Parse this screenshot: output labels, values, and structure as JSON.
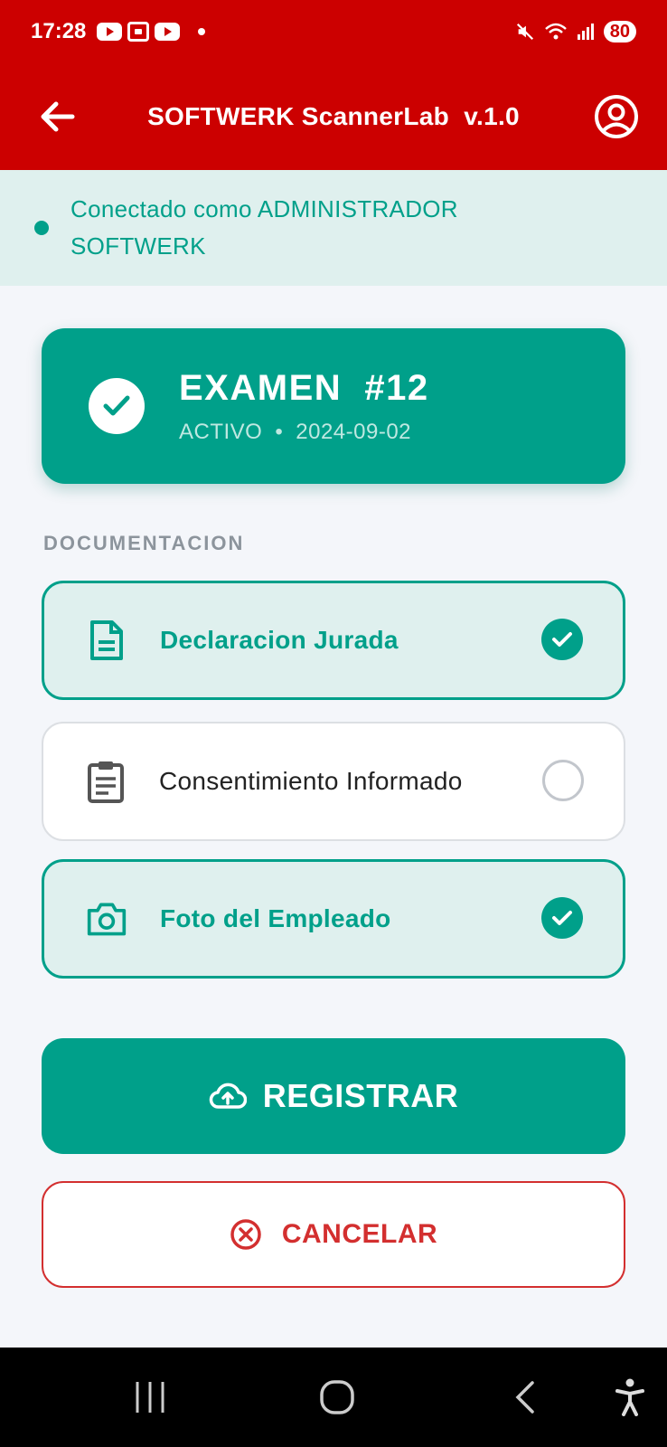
{
  "status_bar": {
    "time": "17:28",
    "battery": "80",
    "icons": [
      "youtube-icon",
      "screenshot-icon",
      "youtube-icon",
      "mute-icon",
      "wifi-icon",
      "signal-icon"
    ]
  },
  "app_bar": {
    "title": "SOFTWERK ScannerLab  v.1.0",
    "back_icon": "arrow-left-icon",
    "profile_icon": "account-circle-icon"
  },
  "connection": {
    "text": "Conectado como ADMINISTRADOR SOFTWERK",
    "color": "#00a08a"
  },
  "exam": {
    "title": "EXAMEN  #12",
    "status": "ACTIVO",
    "separator": "•",
    "date": "2024-09-02"
  },
  "documentation": {
    "section_label": "DOCUMENTACION",
    "items": [
      {
        "label": "Declaracion Jurada",
        "icon": "document-icon",
        "completed": true
      },
      {
        "label": "Consentimiento Informado",
        "icon": "clipboard-icon",
        "completed": false
      },
      {
        "label": "Foto del Empleado",
        "icon": "camera-icon",
        "completed": true
      }
    ]
  },
  "actions": {
    "register_label": "REGISTRAR",
    "register_icon": "cloud-upload-icon",
    "cancel_label": "CANCELAR",
    "cancel_icon": "cancel-circle-icon"
  },
  "colors": {
    "header": "#cc0000",
    "accent": "#00a08a",
    "danger": "#d32f2f"
  }
}
